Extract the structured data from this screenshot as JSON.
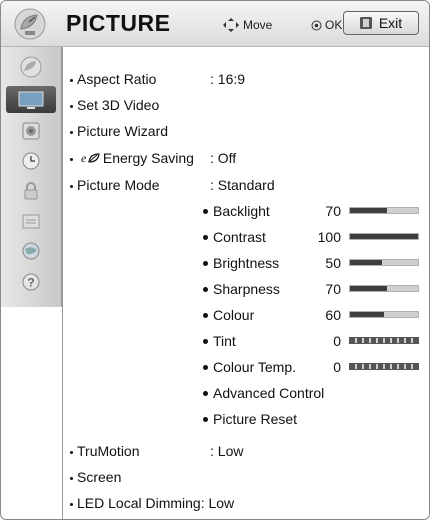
{
  "header": {
    "title": "PICTURE",
    "move_label": "Move",
    "ok_label": "OK",
    "exit_label": "Exit",
    "icon": "satellite-dish-icon"
  },
  "sidebar": {
    "items": [
      {
        "icon": "satellite-dish-icon",
        "active": false
      },
      {
        "icon": "tv-picture-icon",
        "active": true
      },
      {
        "icon": "speaker-icon",
        "active": false
      },
      {
        "icon": "clock-icon",
        "active": false
      },
      {
        "icon": "lock-icon",
        "active": false
      },
      {
        "icon": "option-box-icon",
        "active": false
      },
      {
        "icon": "network-globe-icon",
        "active": false
      },
      {
        "icon": "help-icon",
        "active": false
      }
    ]
  },
  "menu": {
    "aspect_ratio": {
      "label": "Aspect Ratio",
      "value": ": 16:9"
    },
    "set_3d": {
      "label": "Set 3D Video"
    },
    "picture_wizard": {
      "label": "Picture Wizard"
    },
    "energy_saving": {
      "label": "Energy Saving",
      "value": ": Off",
      "icon": "eco-leaf-icon"
    },
    "picture_mode": {
      "label": "Picture Mode",
      "value": ": Standard"
    },
    "settings": [
      {
        "label": "Backlight",
        "value": "70",
        "level": 0.55,
        "bar": "fill"
      },
      {
        "label": "Contrast",
        "value": "100",
        "level": 1.0,
        "bar": "fill"
      },
      {
        "label": "Brightness",
        "value": "50",
        "level": 0.47,
        "bar": "fill"
      },
      {
        "label": "Sharpness",
        "value": "70",
        "level": 0.55,
        "bar": "fill"
      },
      {
        "label": "Colour",
        "value": "60",
        "level": 0.5,
        "bar": "fill"
      },
      {
        "label": "Tint",
        "value": "0",
        "level": 0.5,
        "bar": "striped"
      },
      {
        "label": "Colour Temp.",
        "value": "0",
        "level": 0.5,
        "bar": "striped"
      },
      {
        "label": "Advanced Control"
      },
      {
        "label": "Picture Reset"
      }
    ],
    "trumotion": {
      "label": "TruMotion",
      "value": ": Low"
    },
    "screen": {
      "label": "Screen"
    },
    "led_dimming": {
      "label": "LED Local Dimming: Low"
    }
  },
  "colors": {
    "bar_fill": "#3e3e3e",
    "bar_track": "#d0d0d0",
    "active_tab": "#4a4a4a"
  }
}
